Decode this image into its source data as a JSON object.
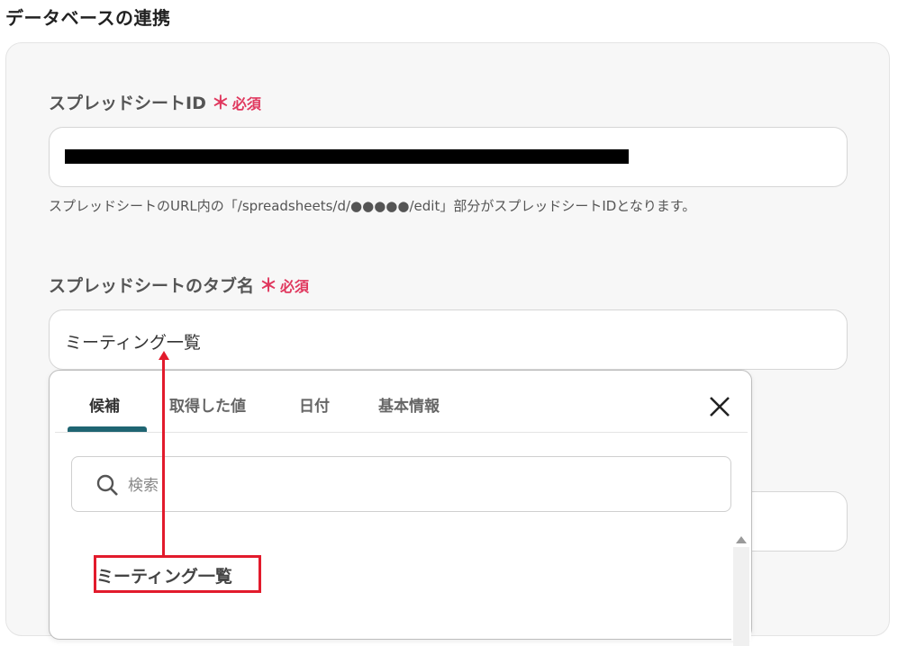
{
  "section": {
    "title": "データベースの連携"
  },
  "fields": [
    {
      "label": "スプレッドシートID",
      "required_star": "＊",
      "required_text": "必須",
      "help": "スプレッドシートのURL内の「/spreadsheets/d/●●●●●/edit」部分がスプレッドシートIDとなります。"
    },
    {
      "label": "スプレッドシートのタブ名",
      "required_star": "＊",
      "required_text": "必須",
      "value": "ミーティング一覧"
    }
  ],
  "dropdown": {
    "tabs": [
      "候補",
      "取得した値",
      "日付",
      "基本情報"
    ],
    "active_tab": "候補",
    "close_icon": "close-icon",
    "search": {
      "placeholder": "検索",
      "icon": "search-icon"
    },
    "options": [
      "ミーティング一覧"
    ]
  },
  "colors": {
    "required": "#e0385e",
    "tab_accent": "#1f6572",
    "annotation": "#e21b2c"
  }
}
